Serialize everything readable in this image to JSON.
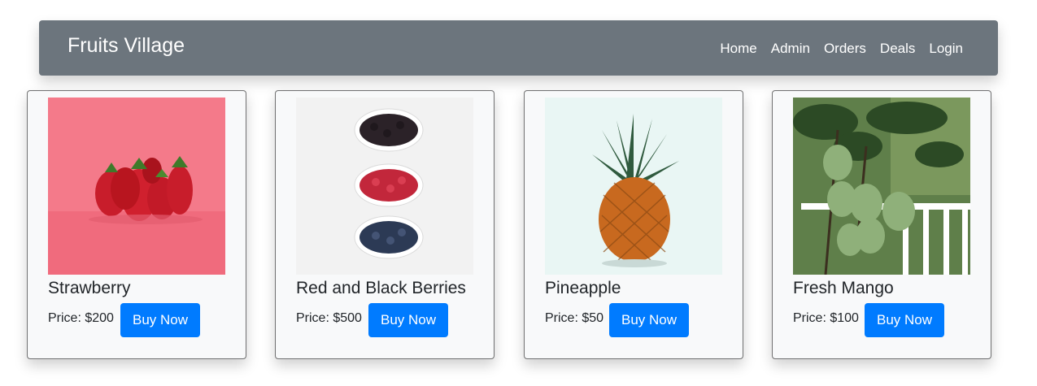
{
  "navbar": {
    "brand": "Fruits Village",
    "links": [
      "Home",
      "Admin",
      "Orders",
      "Deals",
      "Login"
    ]
  },
  "products": [
    {
      "name": "Strawberry",
      "price_text": "Price: $200",
      "button": "Buy Now",
      "image": "strawberry-image"
    },
    {
      "name": "Red and Black Berries",
      "price_text": "Price: $500",
      "button": "Buy Now",
      "image": "berries-image"
    },
    {
      "name": "Pineapple",
      "price_text": "Price: $50",
      "button": "Buy Now",
      "image": "pineapple-image"
    },
    {
      "name": "Fresh Mango",
      "price_text": "Price: $100",
      "button": "Buy Now",
      "image": "mango-image"
    }
  ],
  "colors": {
    "navbar_bg": "#6c757d",
    "button_bg": "#007bff",
    "card_bg": "#f8f9fa"
  }
}
